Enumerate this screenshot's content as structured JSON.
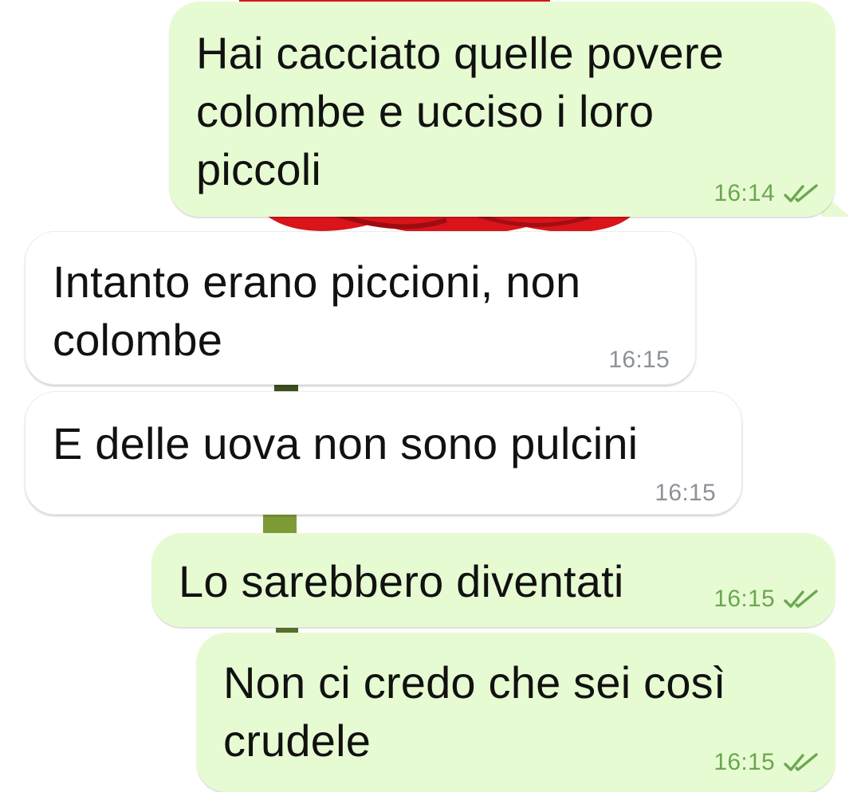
{
  "chat": {
    "messages": [
      {
        "direction": "outgoing",
        "text": "Hai cacciato quelle povere\ncolombe e ucciso i loro\npiccoli",
        "time": "16:14",
        "status": "read-double-check-icon"
      },
      {
        "direction": "incoming",
        "text": "Intanto erano piccioni, non\ncolombe",
        "time": "16:15"
      },
      {
        "direction": "incoming",
        "text": "E delle uova non sono pulcini",
        "time": "16:15"
      },
      {
        "direction": "outgoing",
        "text": "Lo sarebbero diventati",
        "time": "16:15",
        "status": "read-double-check-icon"
      },
      {
        "direction": "outgoing",
        "text": "Non ci credo che sei così\ncrudele",
        "time": "16:15",
        "status": "read-double-check-icon"
      }
    ]
  },
  "colors": {
    "outgoing_bubble": "#e7fbd3",
    "incoming_bubble": "#ffffff",
    "outgoing_time": "#6aa84f",
    "incoming_time": "#8d9198",
    "read_ticks": "#6aa84f",
    "wallpaper_flower": "#d9141b",
    "wallpaper_stem": "#6b8a2a"
  },
  "wallpaper": {
    "icon": "red-rose-wallpaper"
  }
}
